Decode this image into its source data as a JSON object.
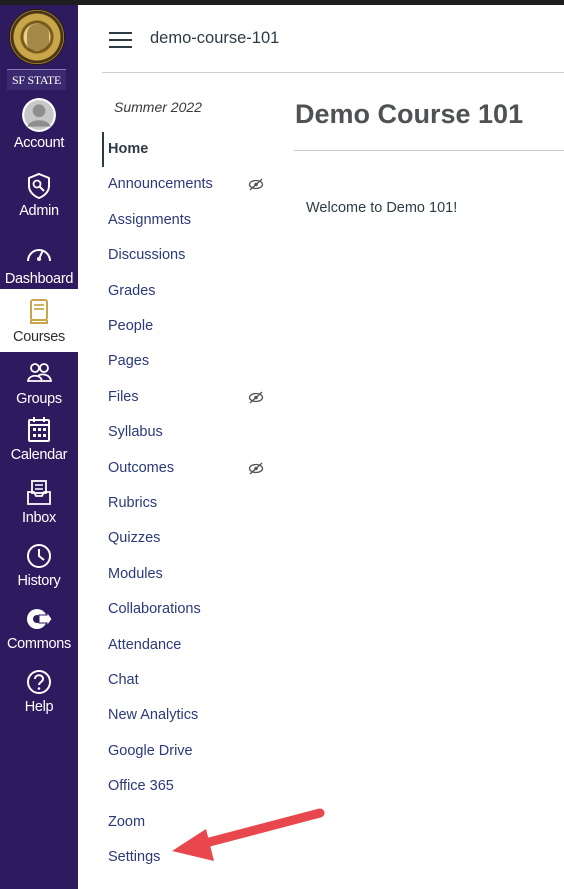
{
  "global_nav": {
    "logo_text": "SF STATE",
    "items": [
      {
        "label": "Account",
        "icon": "account-avatar-icon"
      },
      {
        "label": "Admin",
        "icon": "shield-icon"
      },
      {
        "label": "Dashboard",
        "icon": "gauge-icon"
      },
      {
        "label": "Courses",
        "icon": "book-icon"
      },
      {
        "label": "Groups",
        "icon": "people-icon"
      },
      {
        "label": "Calendar",
        "icon": "calendar-icon"
      },
      {
        "label": "Inbox",
        "icon": "inbox-icon"
      },
      {
        "label": "History",
        "icon": "clock-icon"
      },
      {
        "label": "Commons",
        "icon": "commons-icon"
      },
      {
        "label": "Help",
        "icon": "question-icon"
      }
    ],
    "active": "Courses",
    "colors": {
      "background": "#2e1a5e",
      "accent": "#c9a64a"
    }
  },
  "header": {
    "breadcrumb": "demo-course-101"
  },
  "course_nav": {
    "term": "Summer 2022",
    "items": [
      {
        "label": "Home",
        "active": true
      },
      {
        "label": "Announcements",
        "hidden_from_students": true
      },
      {
        "label": "Assignments"
      },
      {
        "label": "Discussions"
      },
      {
        "label": "Grades"
      },
      {
        "label": "People"
      },
      {
        "label": "Pages"
      },
      {
        "label": "Files",
        "hidden_from_students": true
      },
      {
        "label": "Syllabus"
      },
      {
        "label": "Outcomes",
        "hidden_from_students": true
      },
      {
        "label": "Rubrics"
      },
      {
        "label": "Quizzes"
      },
      {
        "label": "Modules"
      },
      {
        "label": "Collaborations"
      },
      {
        "label": "Attendance"
      },
      {
        "label": "Chat"
      },
      {
        "label": "New Analytics"
      },
      {
        "label": "Google Drive"
      },
      {
        "label": "Office 365"
      },
      {
        "label": "Zoom"
      },
      {
        "label": "Settings"
      }
    ]
  },
  "main": {
    "course_title": "Demo Course 101",
    "welcome_text": "Welcome to Demo 101!"
  },
  "annotation": {
    "arrow_color": "#e8484d",
    "points_to": "Settings"
  }
}
